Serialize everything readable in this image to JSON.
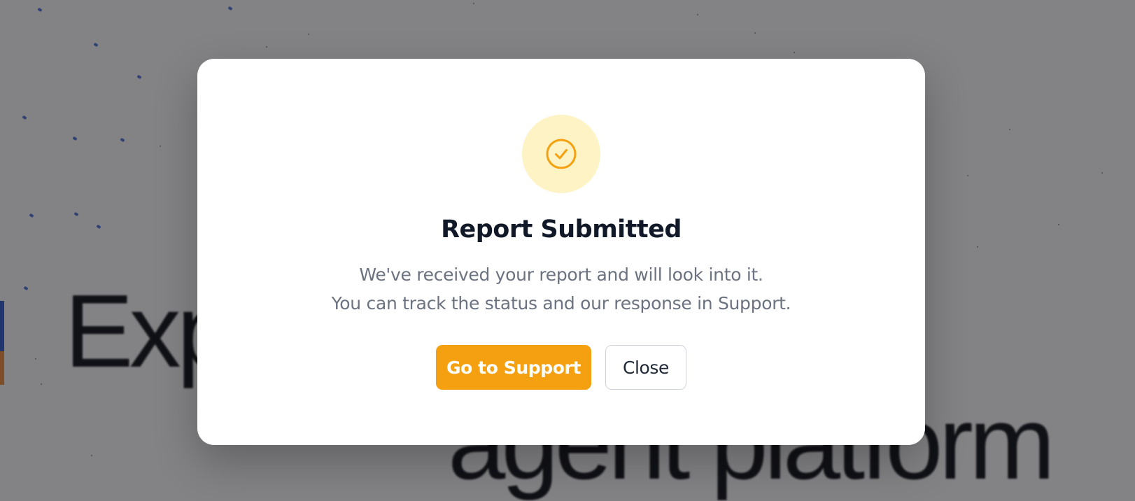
{
  "background": {
    "hero_line_1": "Experience the ne",
    "hero_line_2": "agent platform"
  },
  "modal": {
    "icon": "check-circle-icon",
    "title": "Report Submitted",
    "message_line_1": "We've received your report and will look into it.",
    "message_line_2": "You can track the status and our response in Support.",
    "primary_button_label": "Go to Support",
    "secondary_button_label": "Close"
  },
  "colors": {
    "accent": "#f4a010",
    "badge_background": "#fef3c4",
    "title": "#111827",
    "message": "#6b7280",
    "overlay": "rgba(20,20,24,0.5)"
  }
}
